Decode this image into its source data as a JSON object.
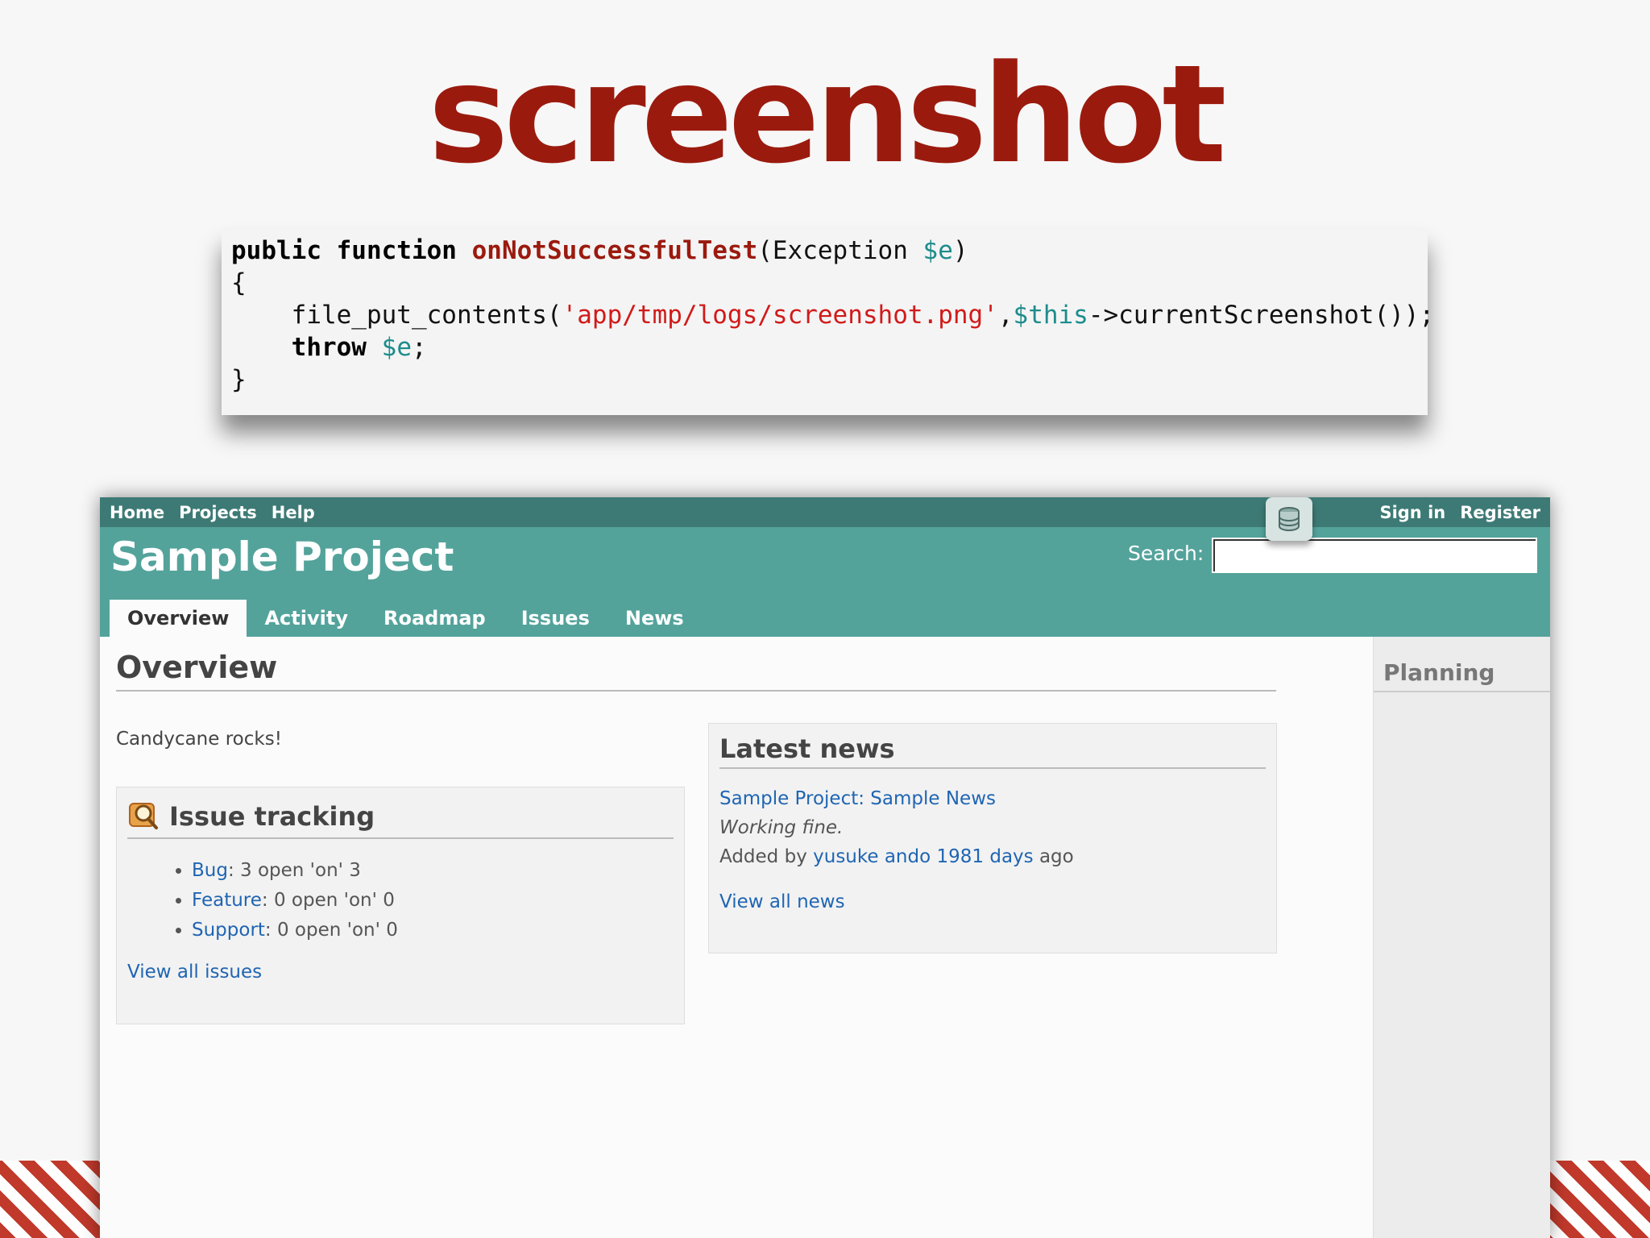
{
  "slide": {
    "title": "screenshot"
  },
  "code": {
    "line1": {
      "kw": "public function ",
      "fn": "onNotSuccessfulTest",
      "open": "(Exception ",
      "var": "$e",
      "close": ")"
    },
    "line2": "{",
    "line3": {
      "indent": "    ",
      "call": "file_put_contents(",
      "str": "'app/tmp/logs/screenshot.png'",
      "comma": ",",
      "var": "$this",
      "rest": "->currentScreenshot());"
    },
    "line4": {
      "indent": "    ",
      "kw": "throw",
      "space": " ",
      "var": "$e",
      "semi": ";"
    },
    "line5": "}"
  },
  "app": {
    "top_menu": {
      "left": [
        "Home",
        "Projects",
        "Help"
      ],
      "right": [
        "Sign in",
        "Register"
      ]
    },
    "header": {
      "project_title": "Sample Project",
      "search_label": "Search:",
      "search_value": ""
    },
    "tabs": [
      "Overview",
      "Activity",
      "Roadmap",
      "Issues",
      "News"
    ],
    "active_tab": "Overview",
    "overview": {
      "heading": "Overview",
      "description": "Candycane rocks!",
      "issue_tracking": {
        "heading": "Issue tracking",
        "items": [
          {
            "tracker": "Bug",
            "text": ": 3 open 'on' 3"
          },
          {
            "tracker": "Feature",
            "text": ": 0 open 'on' 0"
          },
          {
            "tracker": "Support",
            "text": ": 0 open 'on' 0"
          }
        ],
        "view_all": "View all issues"
      },
      "latest_news": {
        "heading": "Latest news",
        "item_title": "Sample Project: Sample News",
        "item_summary": "Working fine.",
        "added_by_prefix": "Added by ",
        "author": "yusuke ando",
        "age": "1981 days",
        "age_suffix": " ago",
        "view_all": "View all news"
      }
    },
    "sidebar": {
      "heading": "Planning"
    },
    "icons": {
      "database": "database-icon",
      "issue_tracking": "magnifier-icon"
    },
    "colors": {
      "header": "#53a39b",
      "top_menu": "#3e7a75",
      "link": "#1f65b3",
      "title": "#9b1a0e"
    }
  }
}
